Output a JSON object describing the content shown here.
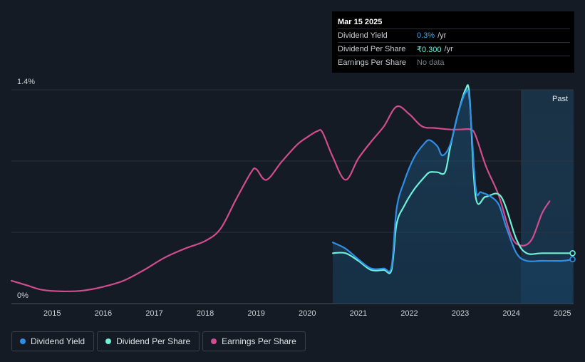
{
  "tooltip": {
    "date": "Mar 15 2025",
    "rows": [
      {
        "label": "Dividend Yield",
        "value": "0.3%",
        "unit": "/yr",
        "color": "#3ea8f2"
      },
      {
        "label": "Dividend Per Share",
        "value": "₹0.300",
        "unit": "/yr",
        "color": "#6ff0d8"
      },
      {
        "label": "Earnings Per Share",
        "value": "No data",
        "unit": "",
        "color": "#777d86"
      }
    ]
  },
  "legend": [
    {
      "label": "Dividend Yield",
      "color": "#2f8fe6"
    },
    {
      "label": "Dividend Per Share",
      "color": "#6ff0d8"
    },
    {
      "label": "Earnings Per Share",
      "color": "#d14d8f"
    }
  ],
  "past_label": "Past",
  "chart_data": {
    "type": "line",
    "y_tick_labels": [
      "1.4%",
      "0%"
    ],
    "ylim": [
      0,
      1.4
    ],
    "xlim": [
      2014.2,
      2025.22
    ],
    "x_ticks": [
      2015,
      2016,
      2017,
      2018,
      2019,
      2020,
      2021,
      2022,
      2023,
      2024,
      2025
    ],
    "grid": true,
    "forecast_start": 2024.2,
    "legend_position": "bottom-left",
    "series": [
      {
        "name": "Dividend Yield",
        "color": "#2f8fe6",
        "area": true,
        "points": [
          [
            2020.5,
            0.4
          ],
          [
            2020.75,
            0.36
          ],
          [
            2021.0,
            0.29
          ],
          [
            2021.25,
            0.23
          ],
          [
            2021.5,
            0.23
          ],
          [
            2021.65,
            0.24
          ],
          [
            2021.75,
            0.62
          ],
          [
            2021.9,
            0.8
          ],
          [
            2022.1,
            0.96
          ],
          [
            2022.3,
            1.05
          ],
          [
            2022.4,
            1.07
          ],
          [
            2022.55,
            1.03
          ],
          [
            2022.65,
            0.97
          ],
          [
            2022.8,
            1.04
          ],
          [
            2022.95,
            1.24
          ],
          [
            2023.1,
            1.38
          ],
          [
            2023.18,
            1.33
          ],
          [
            2023.3,
            0.76
          ],
          [
            2023.4,
            0.73
          ],
          [
            2023.55,
            0.71
          ],
          [
            2023.75,
            0.65
          ],
          [
            2023.9,
            0.5
          ],
          [
            2024.1,
            0.33
          ],
          [
            2024.3,
            0.28
          ],
          [
            2024.6,
            0.28
          ],
          [
            2025.0,
            0.28
          ],
          [
            2025.2,
            0.29
          ]
        ]
      },
      {
        "name": "Dividend Per Share",
        "color": "#6ff0d8",
        "area": false,
        "points": [
          [
            2020.5,
            0.33
          ],
          [
            2020.75,
            0.33
          ],
          [
            2021.0,
            0.28
          ],
          [
            2021.25,
            0.22
          ],
          [
            2021.5,
            0.22
          ],
          [
            2021.65,
            0.22
          ],
          [
            2021.75,
            0.52
          ],
          [
            2021.9,
            0.64
          ],
          [
            2022.1,
            0.75
          ],
          [
            2022.3,
            0.83
          ],
          [
            2022.4,
            0.86
          ],
          [
            2022.55,
            0.86
          ],
          [
            2022.7,
            0.86
          ],
          [
            2022.8,
            1.02
          ],
          [
            2022.95,
            1.24
          ],
          [
            2023.1,
            1.4
          ],
          [
            2023.18,
            1.36
          ],
          [
            2023.3,
            0.7
          ],
          [
            2023.5,
            0.7
          ],
          [
            2023.8,
            0.7
          ],
          [
            2024.1,
            0.42
          ],
          [
            2024.3,
            0.33
          ],
          [
            2024.6,
            0.33
          ],
          [
            2025.0,
            0.33
          ],
          [
            2025.2,
            0.33
          ]
        ]
      },
      {
        "name": "Earnings Per Share",
        "color": "#d14d8f",
        "area": false,
        "points": [
          [
            2014.2,
            0.15
          ],
          [
            2014.5,
            0.12
          ],
          [
            2014.8,
            0.09
          ],
          [
            2015.2,
            0.08
          ],
          [
            2015.6,
            0.085
          ],
          [
            2016.0,
            0.11
          ],
          [
            2016.4,
            0.15
          ],
          [
            2016.8,
            0.22
          ],
          [
            2017.2,
            0.3
          ],
          [
            2017.6,
            0.36
          ],
          [
            2018.0,
            0.41
          ],
          [
            2018.3,
            0.49
          ],
          [
            2018.6,
            0.68
          ],
          [
            2018.9,
            0.86
          ],
          [
            2019.0,
            0.88
          ],
          [
            2019.2,
            0.81
          ],
          [
            2019.5,
            0.93
          ],
          [
            2019.8,
            1.04
          ],
          [
            2020.0,
            1.09
          ],
          [
            2020.2,
            1.13
          ],
          [
            2020.3,
            1.12
          ],
          [
            2020.5,
            0.96
          ],
          [
            2020.75,
            0.81
          ],
          [
            2021.0,
            0.95
          ],
          [
            2021.25,
            1.06
          ],
          [
            2021.5,
            1.16
          ],
          [
            2021.75,
            1.29
          ],
          [
            2022.0,
            1.24
          ],
          [
            2022.25,
            1.16
          ],
          [
            2022.5,
            1.15
          ],
          [
            2022.8,
            1.14
          ],
          [
            2023.0,
            1.14
          ],
          [
            2023.2,
            1.14
          ],
          [
            2023.3,
            1.1
          ],
          [
            2023.5,
            0.9
          ],
          [
            2023.75,
            0.71
          ],
          [
            2024.0,
            0.44
          ],
          [
            2024.2,
            0.38
          ],
          [
            2024.4,
            0.42
          ],
          [
            2024.6,
            0.59
          ],
          [
            2024.75,
            0.67
          ]
        ]
      }
    ]
  }
}
